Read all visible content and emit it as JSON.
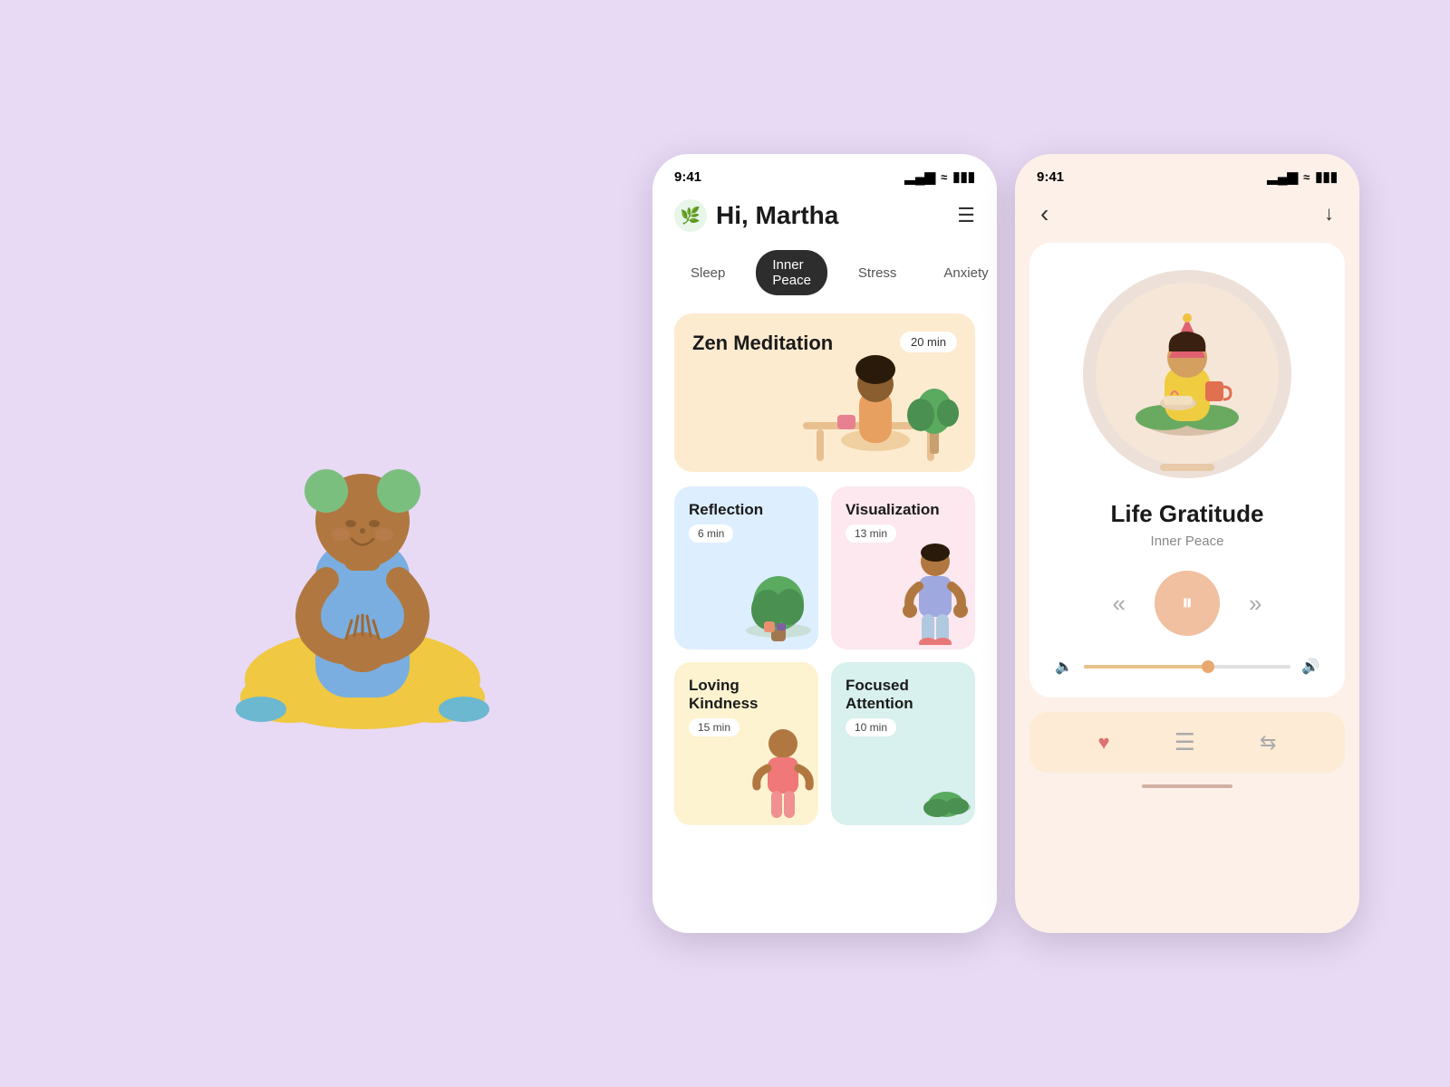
{
  "bg_color": "#e8d9f5",
  "left_figure": {
    "alt": "Meditating person illustration"
  },
  "phone_home": {
    "status_time": "9:41",
    "greeting": "Hi, Martha",
    "menu_icon": "☰",
    "tabs": [
      {
        "label": "Sleep",
        "active": false
      },
      {
        "label": "Inner Peace",
        "active": true
      },
      {
        "label": "Stress",
        "active": false
      },
      {
        "label": "Anxiety",
        "active": false
      }
    ],
    "featured": {
      "title": "Zen Meditation",
      "duration": "20 min",
      "bg": "#fdebd0"
    },
    "cards": [
      {
        "title": "Reflection",
        "duration": "6 min",
        "bg": "card-blue"
      },
      {
        "title": "Visualization",
        "duration": "13 min",
        "bg": "card-pink"
      },
      {
        "title": "Loving Kindness",
        "duration": "15 min",
        "bg": "card-yellow"
      },
      {
        "title": "Focused Attention",
        "duration": "10 min",
        "bg": "card-teal"
      }
    ]
  },
  "phone_player": {
    "status_time": "9:41",
    "track_title": "Life Gratitude",
    "track_subtitle": "Inner Peace",
    "volume_pct": 60
  },
  "icons": {
    "back": "‹",
    "download": "↓",
    "rewind": "«",
    "pause": "⏸",
    "forward": "»",
    "vol_low": "🔈",
    "vol_high": "🔊",
    "heart": "♥",
    "playlist": "≡",
    "shuffle": "⇄",
    "leaf": "🌿",
    "signal": "▂▄▆",
    "wifi": "WiFi",
    "battery": "🔋"
  }
}
